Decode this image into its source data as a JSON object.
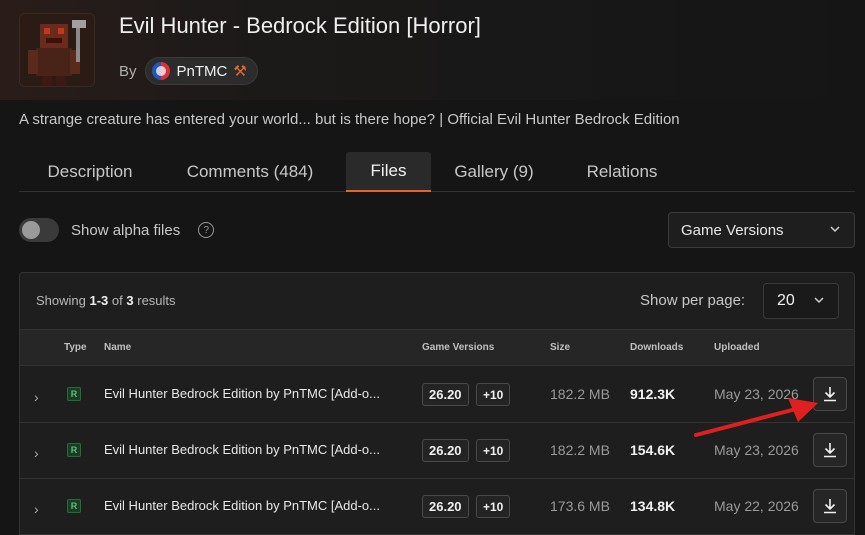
{
  "project": {
    "title": "Evil Hunter - Bedrock Edition [Horror]",
    "by_label": "By",
    "author": "PnTMC",
    "summary": "A strange creature has entered your world... but is there hope? | Official Evil Hunter Bedrock Edition"
  },
  "tabs": [
    {
      "label": "Description"
    },
    {
      "label": "Comments (484)"
    },
    {
      "label": "Files",
      "active": true
    },
    {
      "label": "Gallery (9)"
    },
    {
      "label": "Relations"
    }
  ],
  "filters": {
    "alpha_label": "Show alpha files",
    "alpha_enabled": false,
    "game_versions_label": "Game Versions"
  },
  "results": {
    "showing_prefix": "Showing",
    "range": "1-3",
    "of": "of",
    "total": "3",
    "suffix": "results",
    "per_page_label": "Show per page:",
    "per_page_value": "20"
  },
  "columns": [
    "Type",
    "Name",
    "Game Versions",
    "Size",
    "Downloads",
    "Uploaded"
  ],
  "files": [
    {
      "type": "R",
      "name": "Evil Hunter Bedrock Edition by PnTMC [Add-o...",
      "version": "26.20",
      "more": "+10",
      "size": "182.2 MB",
      "downloads": "912.3K",
      "uploaded": "May 23, 2026"
    },
    {
      "type": "R",
      "name": "Evil Hunter Bedrock Edition by PnTMC [Add-o...",
      "version": "26.20",
      "more": "+10",
      "size": "182.2 MB",
      "downloads": "154.6K",
      "uploaded": "May 23, 2026"
    },
    {
      "type": "R",
      "name": "Evil Hunter Bedrock Edition by PnTMC [Add-o...",
      "version": "26.20",
      "more": "+10",
      "size": "173.6 MB",
      "downloads": "134.8K",
      "uploaded": "May 22, 2026"
    }
  ],
  "colors": {
    "accent": "#e8622a",
    "release_badge": "#55c07a",
    "annotation_arrow": "#e02020"
  }
}
